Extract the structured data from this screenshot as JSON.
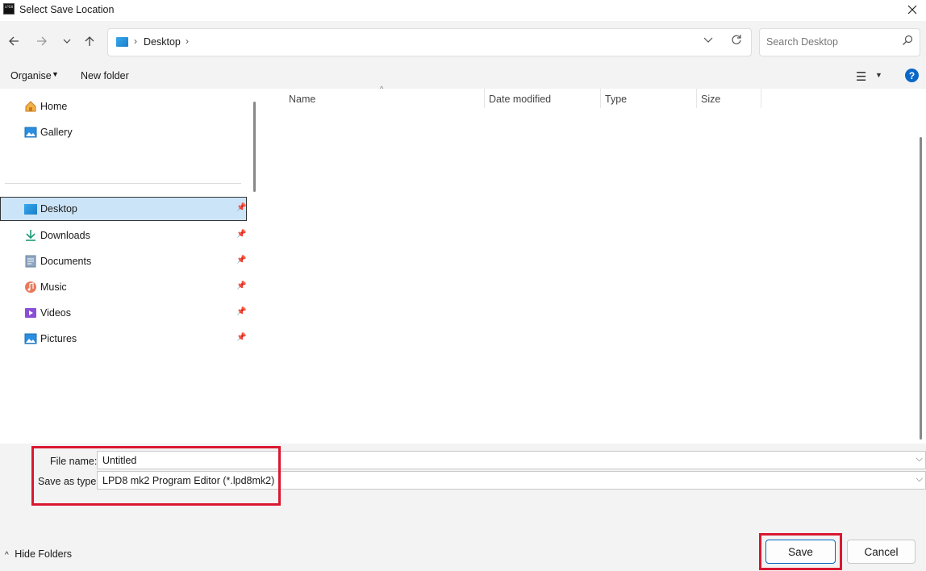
{
  "window": {
    "title": "Select Save Location",
    "app_icon_text": "LPD8"
  },
  "nav": {
    "back_icon": "arrow-left-icon",
    "forward_icon": "arrow-right-icon",
    "recent_icon": "chevron-down-icon",
    "up_icon": "arrow-up-icon",
    "address": {
      "segment": "Desktop",
      "sep": "›"
    },
    "search_placeholder": "Search Desktop"
  },
  "toolbar": {
    "organise": "Organise",
    "new_folder": "New folder"
  },
  "sidebar": {
    "quick": [
      {
        "label": "Home",
        "icon": "home-icon"
      },
      {
        "label": "Gallery",
        "icon": "gallery-icon"
      }
    ],
    "pinned": [
      {
        "label": "Desktop",
        "icon": "desktop-icon",
        "selected": true
      },
      {
        "label": "Downloads",
        "icon": "downloads-icon"
      },
      {
        "label": "Documents",
        "icon": "documents-icon"
      },
      {
        "label": "Music",
        "icon": "music-icon"
      },
      {
        "label": "Videos",
        "icon": "videos-icon"
      },
      {
        "label": "Pictures",
        "icon": "pictures-icon"
      }
    ]
  },
  "columns": {
    "name": "Name",
    "date": "Date modified",
    "type": "Type",
    "size": "Size"
  },
  "form": {
    "file_name_label": "File name:",
    "file_name_value": "Untitled",
    "save_type_label": "Save as type:",
    "save_type_value": "LPD8 mk2 Program Editor (*.lpd8mk2)"
  },
  "footer": {
    "hide_folders": "Hide Folders",
    "save": "Save",
    "cancel": "Cancel"
  },
  "colors": {
    "accent": "#0067c0",
    "highlight": "#d9182f",
    "selected_bg": "#cce4f7"
  }
}
